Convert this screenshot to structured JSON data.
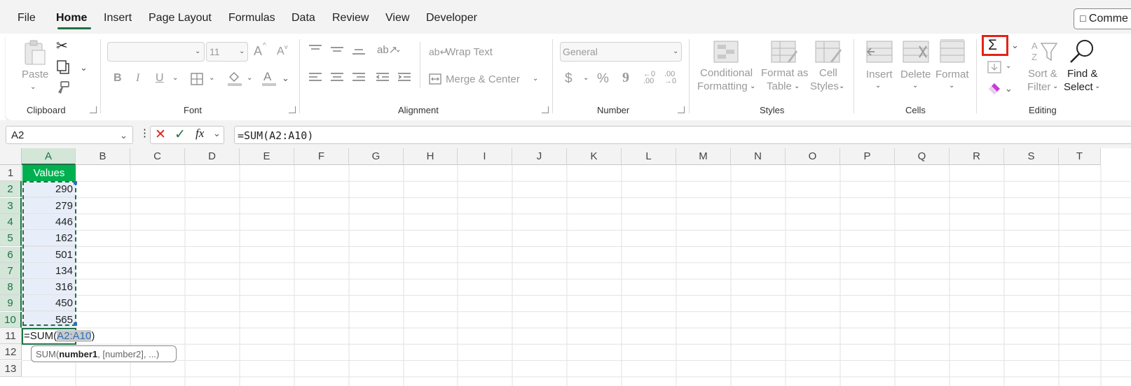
{
  "menu": {
    "tabs": [
      "File",
      "Home",
      "Insert",
      "Page Layout",
      "Formulas",
      "Data",
      "Review",
      "View",
      "Developer"
    ],
    "active_tab": "Home",
    "comments_label": "Comme"
  },
  "ribbon": {
    "clipboard": {
      "label": "Clipboard",
      "paste": "Paste"
    },
    "font": {
      "label": "Font",
      "size": "11",
      "bold": "B",
      "italic": "I",
      "underline": "U",
      "increase": "A",
      "decrease": "A",
      "font_color": "A"
    },
    "alignment": {
      "label": "Alignment",
      "wrap_text": "Wrap Text",
      "merge_center": "Merge & Center"
    },
    "number": {
      "label": "Number",
      "format": "General",
      "currency": "$",
      "percent": "%",
      "comma": "9"
    },
    "styles": {
      "label": "Styles",
      "conditional_1": "Conditional",
      "conditional_2": "Formatting",
      "format_table_1": "Format as",
      "format_table_2": "Table",
      "cell_styles_1": "Cell",
      "cell_styles_2": "Styles"
    },
    "cells": {
      "label": "Cells",
      "insert": "Insert",
      "delete": "Delete",
      "format": "Format"
    },
    "editing": {
      "label": "Editing",
      "autosum_symbol": "Σ",
      "sort_1": "Sort &",
      "sort_2": "Filter",
      "find_1": "Find &",
      "find_2": "Select"
    }
  },
  "formula_bar": {
    "name_box": "A2",
    "formula": "=SUM(A2:A10)",
    "fx": "fx"
  },
  "sheet": {
    "columns": [
      "A",
      "B",
      "C",
      "D",
      "E",
      "F",
      "G",
      "H",
      "I",
      "J",
      "K",
      "L",
      "M",
      "N",
      "O",
      "P",
      "Q",
      "R",
      "S",
      "T"
    ],
    "rows": [
      "1",
      "2",
      "3",
      "4",
      "5",
      "6",
      "7",
      "8",
      "9",
      "10",
      "11",
      "12",
      "13"
    ],
    "header_cell": "Values",
    "values": [
      "290",
      "279",
      "446",
      "162",
      "501",
      "134",
      "316",
      "450",
      "565"
    ],
    "editing_cell": {
      "prefix": "=SUM(",
      "ref": "A2:A10",
      "suffix": ")"
    },
    "tooltip": {
      "prefix": "SUM(",
      "arg1": "number1",
      "rest": ", [number2], ...)"
    }
  },
  "colors": {
    "accent": "#1e7145",
    "header_fill": "#00b050",
    "highlight": "#e2231a",
    "selection_fill": "#e8eef9"
  }
}
